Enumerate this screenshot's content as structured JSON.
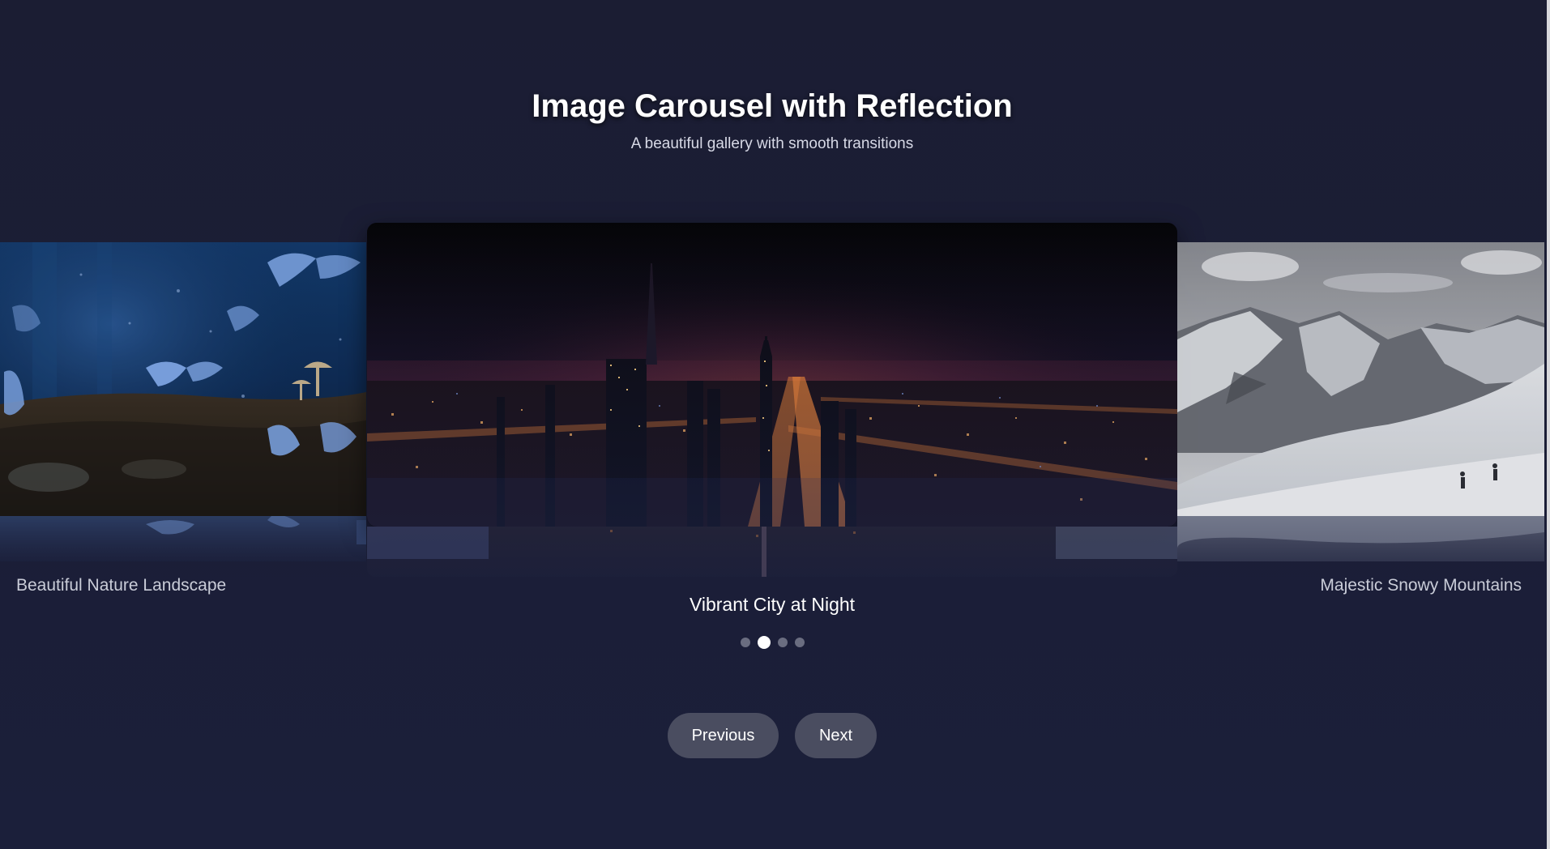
{
  "header": {
    "title": "Image Carousel with Reflection",
    "subtitle": "A beautiful gallery with smooth transitions"
  },
  "carousel": {
    "slides": [
      {
        "caption": "Beautiful Nature Landscape",
        "position": "previous"
      },
      {
        "caption": "Vibrant City at Night",
        "position": "current"
      },
      {
        "caption": "Majestic Snowy Mountains",
        "position": "next"
      }
    ],
    "indicator_count": 4,
    "active_index": 1
  },
  "controls": {
    "previous_label": "Previous",
    "next_label": "Next"
  },
  "colors": {
    "background": "#1b1e35",
    "button": "#4a4d60",
    "dot_active": "#ffffff",
    "dot_inactive": "#6a6d80"
  }
}
